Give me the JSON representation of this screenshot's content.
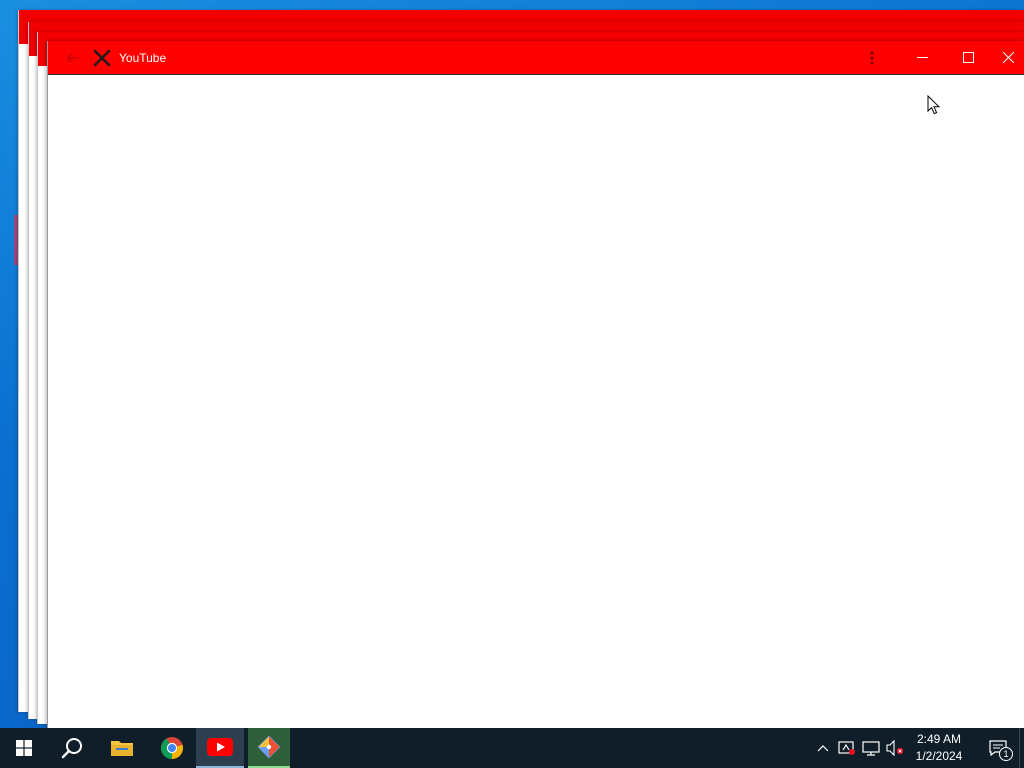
{
  "window": {
    "title": "YouTube",
    "accent_color": "#ff0000"
  },
  "titlebar_icons": {
    "back": "back-arrow-icon",
    "logo": "x-logo-icon",
    "more": "more-vertical-icon",
    "minimize": "minimize-icon",
    "maximize": "maximize-icon",
    "close": "close-icon"
  },
  "taskbar": {
    "apps": [
      {
        "name": "start",
        "icon": "windows-logo-icon"
      },
      {
        "name": "search",
        "icon": "search-icon"
      },
      {
        "name": "file-explorer",
        "icon": "folder-icon"
      },
      {
        "name": "chrome",
        "icon": "chrome-icon"
      },
      {
        "name": "youtube",
        "icon": "youtube-icon"
      },
      {
        "name": "git",
        "icon": "git-icon"
      }
    ],
    "tray": {
      "chevron": "chevron-up-icon",
      "icons": [
        "security-icon",
        "network-icon",
        "volume-muted-icon"
      ]
    },
    "clock": {
      "time": "2:49 AM",
      "date": "1/2/2024"
    },
    "notifications": {
      "count": "1",
      "icon": "action-center-icon"
    }
  }
}
